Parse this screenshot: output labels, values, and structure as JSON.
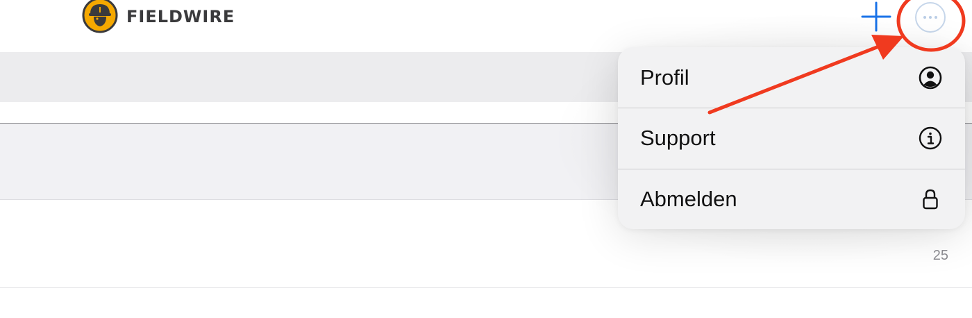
{
  "header": {
    "logo_text": "FIELDWIRE",
    "logo_icon": "worker-hardhat-icon",
    "add_icon": "plus-icon",
    "more_icon": "ellipsis-circle-icon"
  },
  "list": {
    "count_value": "25"
  },
  "menu": {
    "items": [
      {
        "label": "Profil",
        "icon": "person-circle-icon"
      },
      {
        "label": "Support",
        "icon": "info-circle-icon"
      },
      {
        "label": "Abmelden",
        "icon": "lock-icon"
      }
    ]
  },
  "annotation": {
    "color": "#f03a1f",
    "type": "arrow-and-circle"
  },
  "colors": {
    "accent_blue": "#1a73e8",
    "logo_yellow": "#f5a800",
    "annotation_red": "#f03a1f"
  }
}
